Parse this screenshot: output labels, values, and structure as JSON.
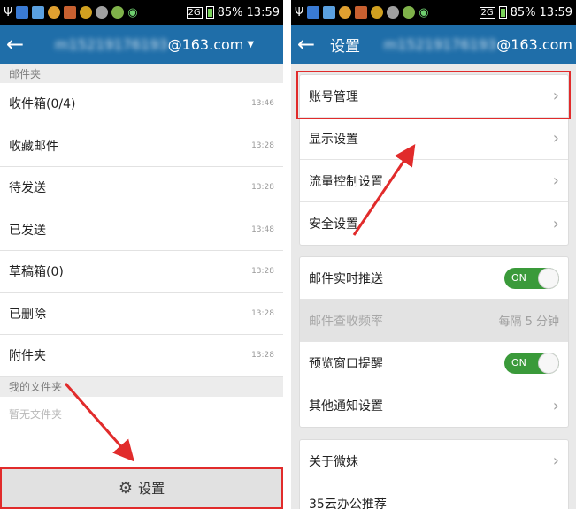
{
  "status": {
    "battery": "85%",
    "time": "13:59",
    "signal": "2G"
  },
  "left": {
    "account": {
      "visible_suffix": "@163.com",
      "obscured": "m15219176193"
    },
    "sections": {
      "mailfolders": "邮件夹",
      "myfolders": "我的文件夹"
    },
    "folders": [
      {
        "label": "收件箱(0/4)",
        "time": "13:46"
      },
      {
        "label": "收藏邮件",
        "time": "13:28"
      },
      {
        "label": "待发送",
        "time": "13:28"
      },
      {
        "label": "已发送",
        "time": "13:48"
      },
      {
        "label": "草稿箱(0)",
        "time": "13:28"
      },
      {
        "label": "已删除",
        "time": "13:28"
      },
      {
        "label": "附件夹",
        "time": "13:28"
      }
    ],
    "empty_text": "暂无文件夹",
    "settings_label": "设置"
  },
  "right": {
    "title": "设置",
    "account": {
      "visible_suffix": "@163.com",
      "obscured": "m15219176193"
    },
    "group1": [
      "账号管理",
      "显示设置",
      "流量控制设置",
      "安全设置"
    ],
    "group2": {
      "push": "邮件实时推送",
      "frequency": "邮件查收频率",
      "frequency_value": "每隔 5 分钟",
      "preview": "预览窗口提醒",
      "other": "其他通知设置",
      "toggle_on": "ON"
    },
    "group3": [
      "关于微妹",
      "35云办公推荐"
    ]
  },
  "colors": {
    "appbar": "#1f6ea9",
    "highlight": "#e12b2b",
    "toggle": "#3a9a3a"
  }
}
